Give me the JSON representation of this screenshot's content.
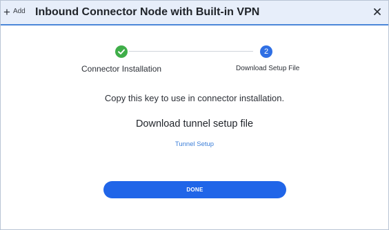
{
  "header": {
    "add_label": "Add",
    "title": "Inbound Connector Node with Built-in VPN"
  },
  "stepper": {
    "steps": [
      {
        "label": "Connector Installation",
        "status": "complete"
      },
      {
        "label": "Download Setup File",
        "number": "2",
        "status": "active"
      }
    ]
  },
  "main": {
    "instruction": "Copy this key to use in connector installation.",
    "subheading": "Download tunnel setup file",
    "link_label": "Tunnel Setup",
    "done_label": "DONE"
  },
  "colors": {
    "accent": "#2065e8",
    "success": "#3fae49",
    "header_bg": "#e7eefa",
    "link": "#3b7ed8"
  },
  "icons": {
    "add": "plus-icon",
    "close": "close-icon",
    "step_complete": "check-icon"
  }
}
